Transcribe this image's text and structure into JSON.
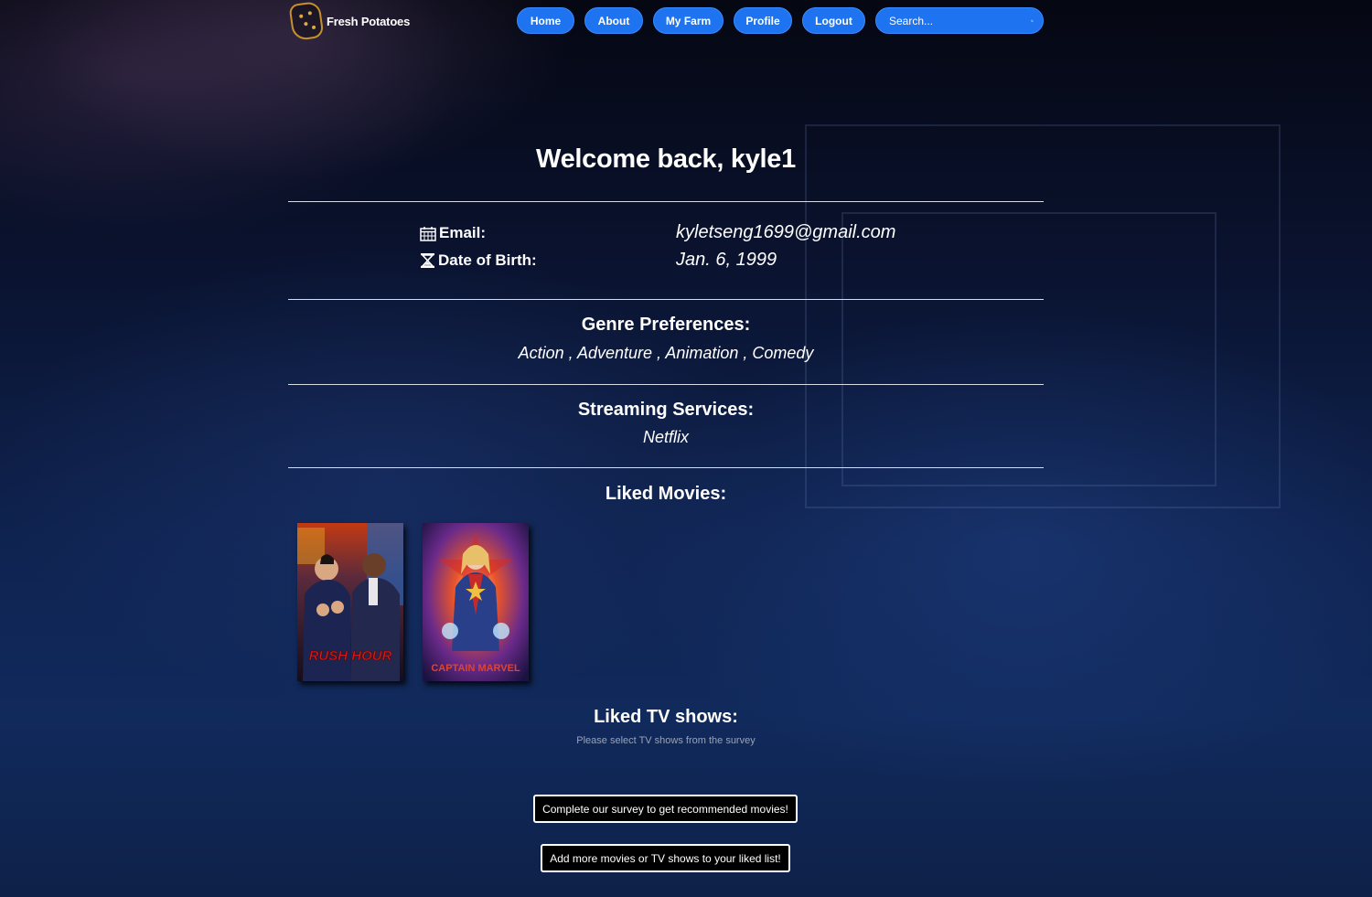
{
  "nav": {
    "brand": "Fresh Potatoes",
    "items": [
      {
        "label": "Home"
      },
      {
        "label": "About"
      },
      {
        "label": "My Farm"
      },
      {
        "label": "Profile"
      },
      {
        "label": "Logout"
      }
    ],
    "search_placeholder": "Search...",
    "search_icon": "search-icon",
    "accent_color": "#1e73f0"
  },
  "profile": {
    "welcome": "Welcome back, kyle1",
    "email_label": "Email:",
    "email_icon": "calendar-icon",
    "email_value": "kyletseng1699@gmail.com",
    "dob_label": "Date of Birth:",
    "dob_icon": "hourglass-icon",
    "dob_value": "Jan. 6, 1999"
  },
  "genres": {
    "heading": "Genre Preferences:",
    "items": [
      "Action",
      "Adventure",
      "Animation",
      "Comedy"
    ],
    "text": "Action , Adventure , Animation , Comedy"
  },
  "streaming": {
    "heading": "Streaming Services:",
    "text": "Netflix"
  },
  "liked_movies": {
    "heading": "Liked Movies:",
    "posters": [
      {
        "poster_text": "RUSH HOUR"
      },
      {
        "poster_text": "CAPTAIN MARVEL"
      }
    ]
  },
  "liked_tv": {
    "heading": "Liked TV shows:",
    "hint": "Please select TV shows from the survey"
  },
  "buttons": {
    "survey": "Complete our survey to get recommended movies!",
    "add_more": "Add more movies or TV shows to your liked list!"
  }
}
